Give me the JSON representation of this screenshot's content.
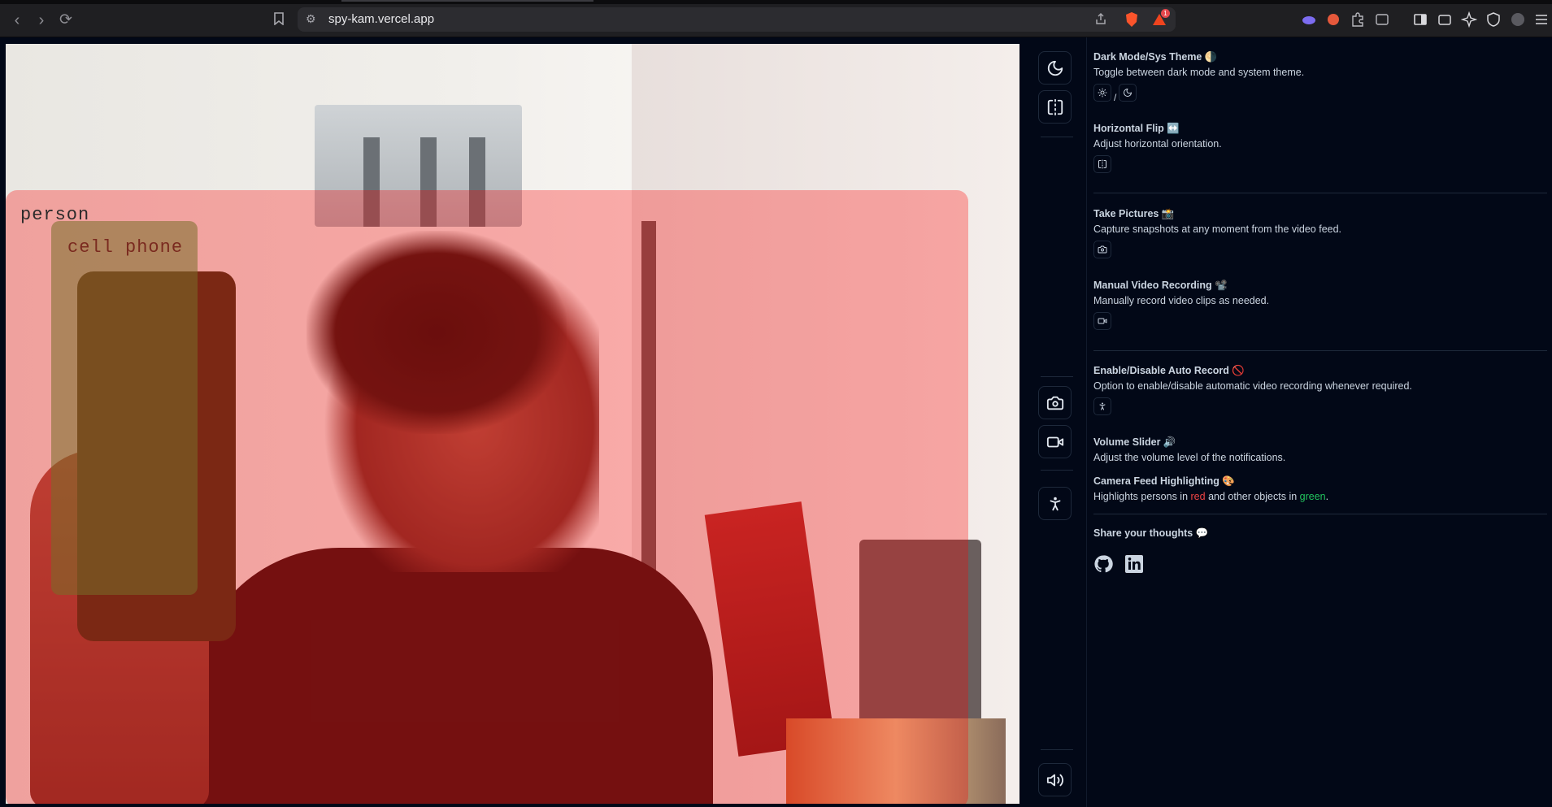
{
  "browser": {
    "url": "spy-kam.vercel.app",
    "notification_count": "1"
  },
  "video": {
    "detections": [
      {
        "label": "person",
        "color": "#ff0000"
      },
      {
        "label": "cell phone",
        "color": "#7a6e28"
      }
    ]
  },
  "toolbar": {
    "buttons": [
      "theme-toggle",
      "horizontal-flip",
      "take-picture",
      "record-video",
      "auto-record",
      "volume"
    ]
  },
  "panel": {
    "theme": {
      "title": "Dark Mode/Sys Theme 🌗",
      "desc": "Toggle between dark mode and system theme.",
      "slash": "/"
    },
    "flip": {
      "title": "Horizontal Flip ↔️",
      "desc": "Adjust horizontal orientation."
    },
    "pictures": {
      "title": "Take Pictures 📸",
      "desc": "Capture snapshots at any moment from the video feed."
    },
    "recording": {
      "title": "Manual Video Recording 📽️",
      "desc": "Manually record video clips as needed."
    },
    "autorecord": {
      "title": "Enable/Disable Auto Record 🚫",
      "desc": "Option to enable/disable automatic video recording whenever required."
    },
    "volume": {
      "title": "Volume Slider 🔊",
      "desc": "Adjust the volume level of the notifications."
    },
    "highlight": {
      "title": "Camera Feed Highlighting 🎨",
      "desc_prefix": "Highlights persons in ",
      "desc_red": "red",
      "desc_mid": " and other objects in ",
      "desc_green": "green",
      "desc_suffix": "."
    },
    "share": {
      "title": "Share your thoughts 💬"
    }
  }
}
